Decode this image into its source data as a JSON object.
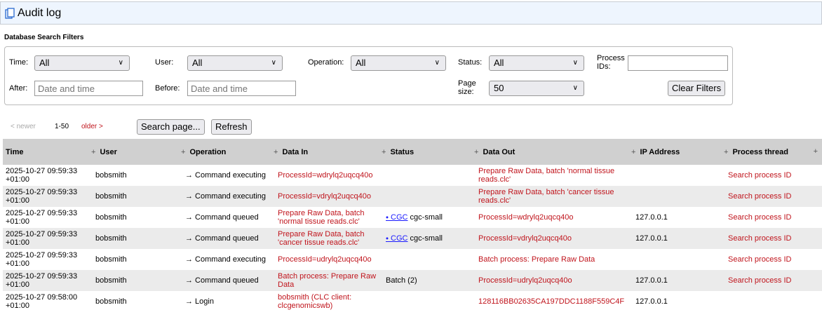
{
  "header": {
    "title": "Audit log",
    "icon": "clipboard-icon"
  },
  "filters": {
    "section_title": "Database Search Filters",
    "time_label": "Time:",
    "time_value": "All",
    "user_label": "User:",
    "user_value": "All",
    "operation_label": "Operation:",
    "operation_value": "All",
    "status_label": "Status:",
    "status_value": "All",
    "process_ids_label": "Process IDs:",
    "process_ids_value": "",
    "after_label": "After:",
    "after_placeholder": "Date and time",
    "before_label": "Before:",
    "before_placeholder": "Date and time",
    "page_size_label": "Page size:",
    "page_size_value": "50",
    "clear_label": "Clear Filters"
  },
  "pager": {
    "newer": "< newer",
    "range": "1-50",
    "older": "older >",
    "search_page": "Search page...",
    "refresh": "Refresh"
  },
  "table": {
    "columns": [
      "Time",
      "User",
      "Operation",
      "Data In",
      "Status",
      "Data Out",
      "IP Address",
      "Process thread"
    ],
    "rows": [
      {
        "time": "2025-10-27 09:59:33 +01:00",
        "user": "bobsmith",
        "operation": "→ Command executing",
        "data_in": "ProcessId=wdrylq2uqcq40o",
        "status_link": "",
        "status": "",
        "data_out": "Prepare Raw Data, batch 'normal tissue reads.clc'",
        "ip": "",
        "thread": "Search process ID"
      },
      {
        "time": "2025-10-27 09:59:33 +01:00",
        "user": "bobsmith",
        "operation": "→ Command executing",
        "data_in": "ProcessId=vdrylq2uqcq40o",
        "status_link": "",
        "status": "",
        "data_out": "Prepare Raw Data, batch 'cancer tissue reads.clc'",
        "ip": "",
        "thread": "Search process ID"
      },
      {
        "time": "2025-10-27 09:59:33 +01:00",
        "user": "bobsmith",
        "operation": "→ Command queued",
        "data_in": "Prepare Raw Data, batch 'normal tissue reads.clc'",
        "status_link": "CGC",
        "status": "cgc-small",
        "data_out": "ProcessId=wdrylq2uqcq40o",
        "ip": "127.0.0.1",
        "thread": "Search process ID"
      },
      {
        "time": "2025-10-27 09:59:33 +01:00",
        "user": "bobsmith",
        "operation": "→ Command queued",
        "data_in": "Prepare Raw Data, batch 'cancer tissue reads.clc'",
        "status_link": "CGC",
        "status": "cgc-small",
        "data_out": "ProcessId=vdrylq2uqcq40o",
        "ip": "127.0.0.1",
        "thread": "Search process ID"
      },
      {
        "time": "2025-10-27 09:59:33 +01:00",
        "user": "bobsmith",
        "operation": "→ Command executing",
        "data_in": "ProcessId=udrylq2uqcq40o",
        "status_link": "",
        "status": "",
        "data_out": "Batch process: Prepare Raw Data",
        "ip": "",
        "thread": "Search process ID"
      },
      {
        "time": "2025-10-27 09:59:33 +01:00",
        "user": "bobsmith",
        "operation": "→ Command queued",
        "data_in": "Batch process: Prepare Raw Data",
        "status_link": "",
        "status": "Batch (2)",
        "data_out": "ProcessId=udrylq2uqcq40o",
        "ip": "127.0.0.1",
        "thread": "Search process ID"
      },
      {
        "time": "2025-10-27 09:58:00 +01:00",
        "user": "bobsmith",
        "operation": "→ Login",
        "data_in": "bobsmith (CLC client: clcgenomicswb)",
        "status_link": "",
        "status": "",
        "data_out": "128116BB02635CA197DDC1188F559C4F",
        "ip": "127.0.0.1",
        "thread": ""
      }
    ]
  }
}
